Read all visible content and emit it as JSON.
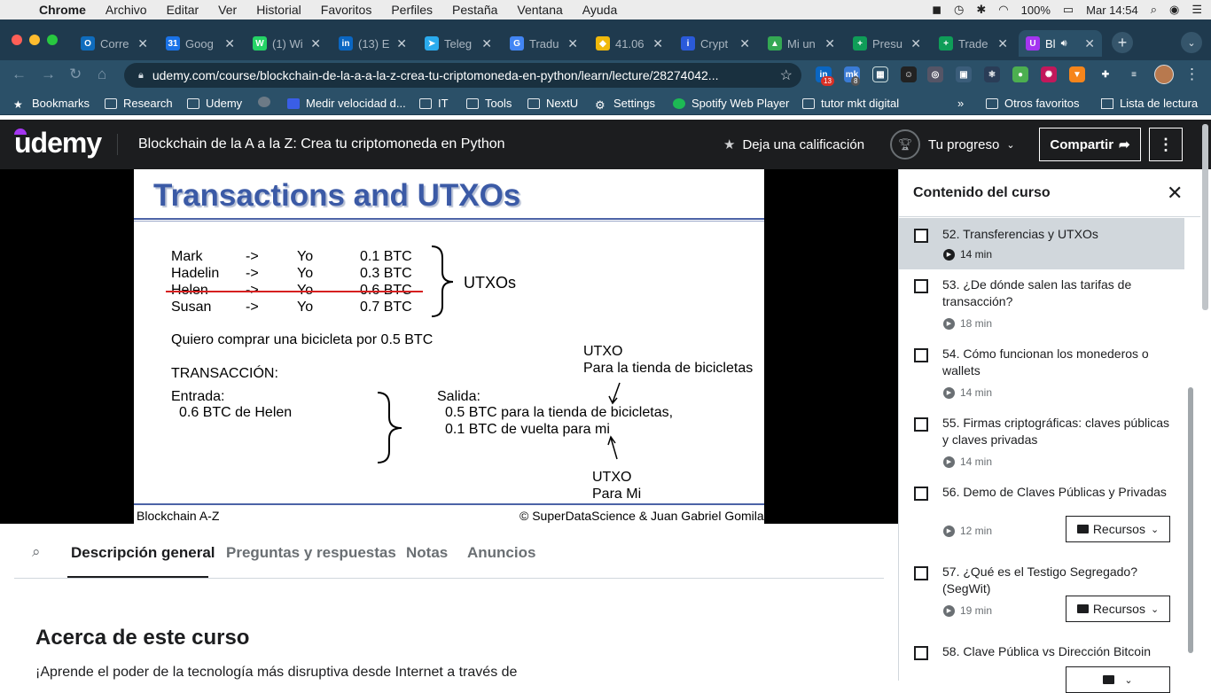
{
  "macbar": {
    "apple": "",
    "menus": [
      "Chrome",
      "Archivo",
      "Editar",
      "Ver",
      "Historial",
      "Favoritos",
      "Perfiles",
      "Pestaña",
      "Ventana",
      "Ayuda"
    ],
    "battery": "100%",
    "clock": "Mar 14:54"
  },
  "tabs": [
    {
      "label": "Corre",
      "color": "#0f6cbd",
      "glyph": "O"
    },
    {
      "label": "Goog",
      "color": "#1a73e8",
      "glyph": "31"
    },
    {
      "label": "(1) Wi",
      "color": "#25d366",
      "glyph": "W"
    },
    {
      "label": "(13) E",
      "color": "#0a66c2",
      "glyph": "in"
    },
    {
      "label": "Teleg",
      "color": "#2aabee",
      "glyph": "➤"
    },
    {
      "label": "Tradu",
      "color": "#4285f4",
      "glyph": "G"
    },
    {
      "label": "41.06",
      "color": "#f0b90b",
      "glyph": "◆"
    },
    {
      "label": "Crypt",
      "color": "#2a5ada",
      "glyph": "i"
    },
    {
      "label": "Mi un",
      "color": "#34a853",
      "glyph": "▲"
    },
    {
      "label": "Presu",
      "color": "#0f9d58",
      "glyph": "+"
    },
    {
      "label": "Trade",
      "color": "#0f9d58",
      "glyph": "+"
    },
    {
      "label": "Bl",
      "color": "#a435f0",
      "glyph": "U",
      "active": true
    }
  ],
  "toolbar": {
    "url": "udemy.com/course/blockchain-de-la-a-a-la-z-crea-tu-criptomoneda-en-python/learn/lecture/28274042...",
    "badge1": "13",
    "badge2": "8"
  },
  "bookmarks": [
    "Bookmarks",
    "Research",
    "Udemy",
    "Medir velocidad d...",
    "IT",
    "Tools",
    "NextU",
    "Settings",
    "Spotify Web Player",
    "tutor mkt digital",
    "Otros favoritos",
    "Lista de lectura"
  ],
  "header": {
    "logo": "udemy",
    "course_title": "Blockchain de la A a la Z: Crea tu criptomoneda en Python",
    "rate_label": "Deja una calificación",
    "progress_label": "Tu progreso",
    "share_label": "Compartir"
  },
  "slide": {
    "title": "Transactions and UTXOs",
    "rows": [
      {
        "from": "Mark",
        "arrow": "->",
        "to": "Yo",
        "amount": "0.1 BTC"
      },
      {
        "from": "Hadelin",
        "arrow": "->",
        "to": "Yo",
        "amount": "0.3 BTC"
      },
      {
        "from": "Helen",
        "arrow": "->",
        "to": "Yo",
        "amount": "0.6 BTC"
      },
      {
        "from": "Susan",
        "arrow": "->",
        "to": "Yo",
        "amount": "0.7 BTC"
      }
    ],
    "utxos_label": "UTXOs",
    "want": "Quiero comprar una bicicleta por 0.5 BTC",
    "tx_label": "TRANSACCIÓN:",
    "entrada": "Entrada:",
    "entrada_value": "0.6 BTC de Helen",
    "salida": "Salida:",
    "salida_1": "0.5 BTC para la tienda de bicicletas,",
    "salida_2": "0.1 BTC de vuelta para mi",
    "utxo_top_1": "UTXO",
    "utxo_top_2": "Para la tienda de bicicletas",
    "utxo_bottom_1": "UTXO",
    "utxo_bottom_2": "Para Mi",
    "footer_left": "Blockchain A-Z",
    "footer_right": "© SuperDataScience & Juan Gabriel Gomila"
  },
  "content_tabs": [
    "Descripción general",
    "Preguntas y respuestas",
    "Notas",
    "Anuncios"
  ],
  "about": {
    "heading": "Acerca de este curso",
    "desc": "¡Aprende el poder de la tecnología más disruptiva desde Internet a través de"
  },
  "sidebar": {
    "title": "Contenido del curso",
    "lectures": [
      {
        "title": "52. Transferencias y UTXOs",
        "duration": "14 min",
        "current": true
      },
      {
        "title": "53. ¿De dónde salen las tarifas de transacción?",
        "duration": "18 min"
      },
      {
        "title": "54. Cómo funcionan los monederos o wallets",
        "duration": "14 min"
      },
      {
        "title": "55. Firmas criptográficas: claves públicas y claves privadas",
        "duration": "14 min"
      },
      {
        "title": "56. Demo de Claves Públicas y Privadas",
        "duration": "12 min",
        "resources": "Recursos"
      },
      {
        "title": "57. ¿Qué es el Testigo Segregado? (SegWit)",
        "duration": "19 min",
        "resources": "Recursos"
      },
      {
        "title": "58. Clave Pública vs Dirección Bitcoin",
        "duration": "",
        "resources": ""
      }
    ]
  }
}
